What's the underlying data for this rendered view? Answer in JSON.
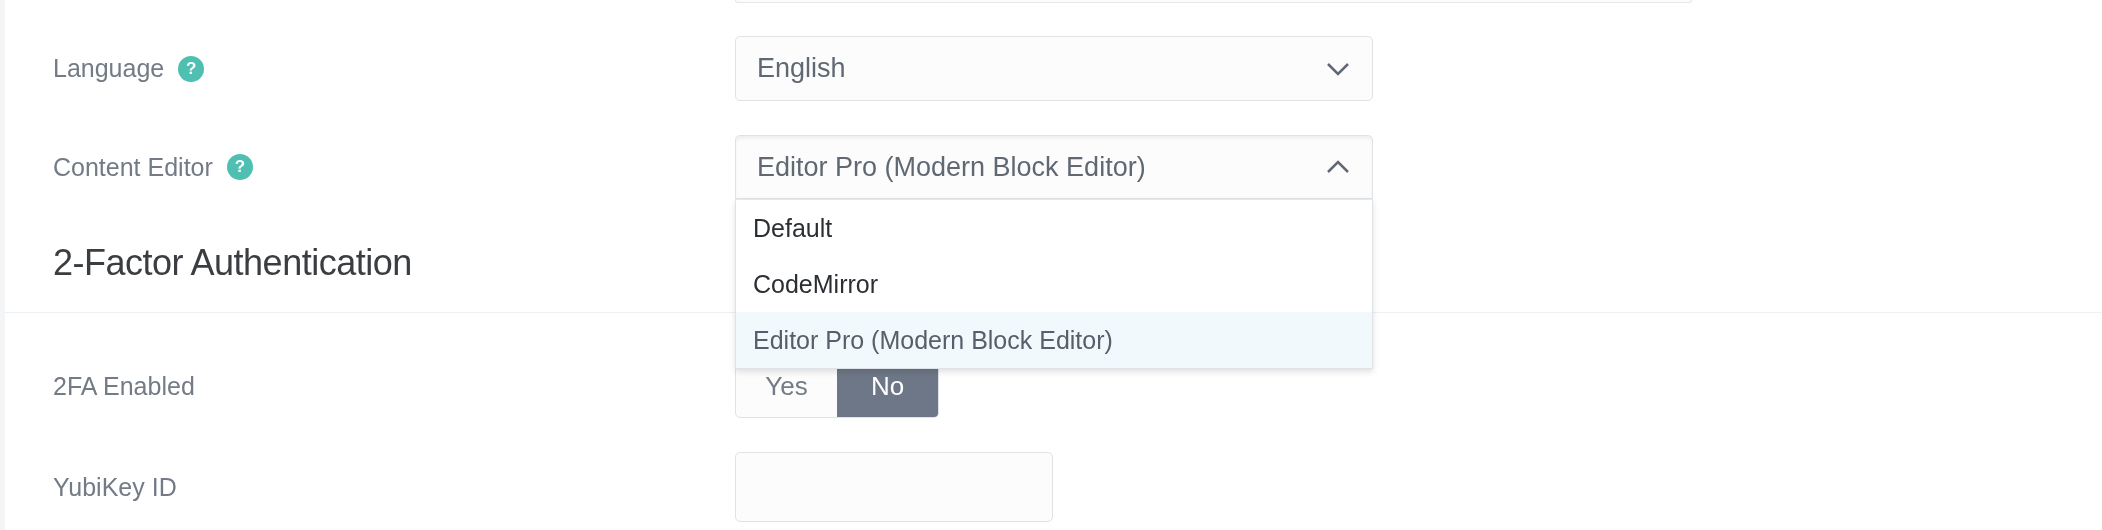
{
  "general_fields": [
    {
      "label": "Language",
      "help": "?",
      "kind": "select",
      "value": "English",
      "expanded": false
    },
    {
      "label": "Content Editor",
      "help": "?",
      "kind": "select",
      "value": "Editor Pro (Modern Block Editor)",
      "expanded": true,
      "options": [
        {
          "label": "Default",
          "selected": false
        },
        {
          "label": "CodeMirror",
          "selected": false
        },
        {
          "label": "Editor Pro (Modern Block Editor)",
          "selected": true
        }
      ]
    }
  ],
  "section": {
    "title": "2-Factor Authentication"
  },
  "security_fields": [
    {
      "label": "2FA Enabled",
      "kind": "toggle",
      "options": [
        {
          "label": "Yes",
          "selected": false
        },
        {
          "label": "No",
          "selected": true
        }
      ]
    },
    {
      "label": "YubiKey ID",
      "kind": "text"
    }
  ]
}
